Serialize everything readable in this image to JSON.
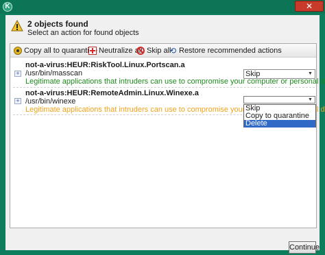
{
  "window": {
    "app_icon": "K",
    "close_label": "✕"
  },
  "header": {
    "title": "2 objects found",
    "subtitle": "Select an action for found objects",
    "icon": "warning-icon"
  },
  "toolbar": {
    "copy_all": "Copy all to quarantine",
    "neutralize_all": "Neutralize all",
    "skip_all": "Skip all",
    "restore": "Restore recommended actions"
  },
  "threats": [
    {
      "name": "not-a-virus:HEUR:RiskTool.Linux.Portscan.a",
      "path": "/usr/bin/masscan",
      "description": "Legitimate applications that intruders can use to compromise your computer or personal data",
      "action": "Skip"
    },
    {
      "name": "not-a-virus:HEUR:RemoteAdmin.Linux.Winexe.a",
      "path": "/usr/bin/winexe",
      "description": "Legitimate applications that intruders can use to compromise your computer or personal data",
      "action": ""
    }
  ],
  "dropdown": {
    "options": [
      "Skip",
      "Copy to quarantine",
      "Delete"
    ],
    "highlighted": "Delete"
  },
  "footer": {
    "continue_label": "Continue"
  },
  "colors": {
    "frame": "#0e7d5e",
    "desc_first": "#1d8a1d",
    "desc_second": "#f0a21a",
    "selection": "#3169c6"
  }
}
